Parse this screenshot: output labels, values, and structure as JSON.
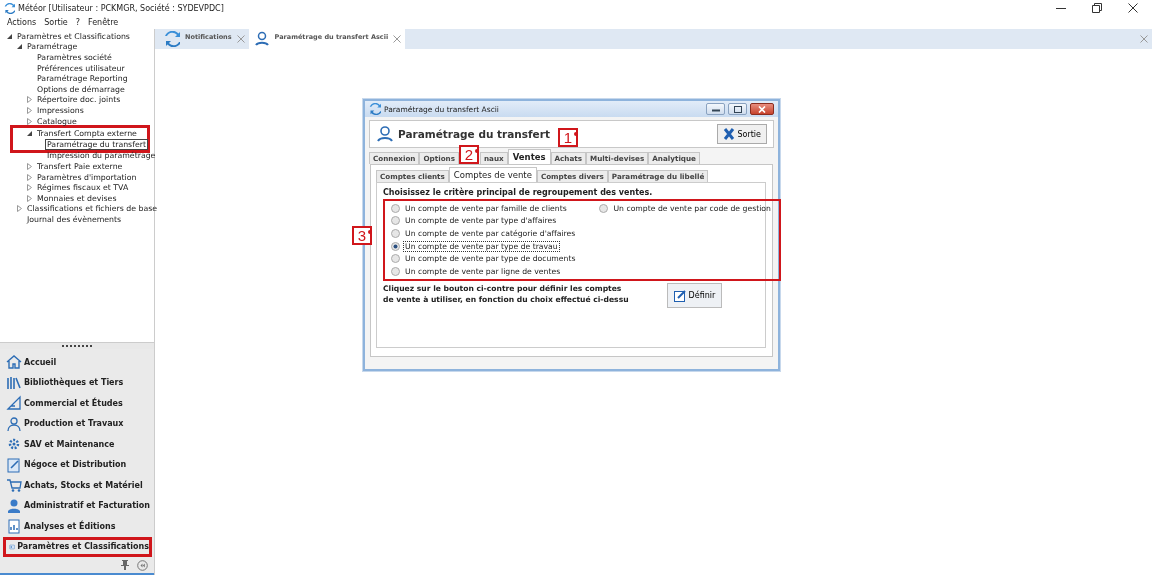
{
  "window": {
    "title": "Météor [Utilisateur : PCKMGR, Société : SYDEVPDC]"
  },
  "menu": [
    "Actions",
    "Sortie",
    "?",
    "Fenêtre"
  ],
  "tree": [
    {
      "label": "Paramètres et Classifications",
      "expanded": true,
      "selected": false,
      "highlighted": false,
      "children": [
        {
          "label": "Paramétrage",
          "expanded": true,
          "selected": false,
          "highlighted": false,
          "children": [
            {
              "label": "Paramètres société",
              "selected": false,
              "highlighted": false
            },
            {
              "label": "Préférences utilisateur",
              "selected": false,
              "highlighted": false
            },
            {
              "label": "Paramétrage Reporting",
              "selected": false,
              "highlighted": false
            },
            {
              "label": "Options de démarrage",
              "selected": false,
              "highlighted": false
            },
            {
              "label": "Répertoire doc. joints",
              "expanded": false,
              "selected": false,
              "highlighted": false
            },
            {
              "label": "Impressions",
              "expanded": false,
              "selected": false,
              "highlighted": false
            },
            {
              "label": "Catalogue",
              "expanded": false,
              "selected": false,
              "highlighted": false
            },
            {
              "label": "Transfert Compta externe",
              "expanded": true,
              "selected": false,
              "highlighted": true,
              "children": [
                {
                  "label": "Paramétrage du transfert",
                  "selected": true,
                  "highlighted": false
                },
                {
                  "label": "Impression du paramétrage",
                  "selected": false,
                  "highlighted": false
                }
              ]
            },
            {
              "label": "Transfert Paie externe",
              "expanded": false,
              "selected": false,
              "highlighted": false
            },
            {
              "label": "Paramètres d'importation",
              "expanded": false,
              "selected": false,
              "highlighted": false
            },
            {
              "label": "Régimes fiscaux et TVA",
              "expanded": false,
              "selected": false,
              "highlighted": false
            },
            {
              "label": "Monnaies et devises",
              "expanded": false,
              "selected": false,
              "highlighted": false
            }
          ]
        },
        {
          "label": "Classifications et fichiers de base",
          "expanded": false,
          "selected": false,
          "highlighted": false
        },
        {
          "label": "Journal des évènements",
          "selected": false,
          "highlighted": false
        }
      ]
    }
  ],
  "nav": [
    {
      "label": "Accueil",
      "highlighted": false
    },
    {
      "label": "Bibliothèques et Tiers",
      "highlighted": false
    },
    {
      "label": "Commercial et Études",
      "highlighted": false
    },
    {
      "label": "Production et Travaux",
      "highlighted": false
    },
    {
      "label": "SAV et Maintenance",
      "highlighted": false
    },
    {
      "label": "Négoce et Distribution",
      "highlighted": false
    },
    {
      "label": "Achats, Stocks et Matériel",
      "highlighted": false
    },
    {
      "label": "Administratif et Facturation",
      "highlighted": false
    },
    {
      "label": "Analyses et Éditions",
      "highlighted": false
    },
    {
      "label": "Paramètres et Classifications",
      "highlighted": true
    }
  ],
  "doc_tabs": [
    {
      "label": "Notifications",
      "selected": false
    },
    {
      "label": "Paramétrage du transfert Ascii",
      "selected": true
    }
  ],
  "dialog": {
    "title": "Paramétrage du transfert Ascii",
    "header": "Paramétrage du transfert",
    "exit_button": "Sortie",
    "tabs": [
      {
        "label": "Connexion",
        "selected": false
      },
      {
        "label": "Options",
        "selected": false
      },
      {
        "label": "naux",
        "selected": false
      },
      {
        "label": "Ventes",
        "selected": true
      },
      {
        "label": "Achats",
        "selected": false
      },
      {
        "label": "Multi-devises",
        "selected": false
      },
      {
        "label": "Analytique",
        "selected": false
      }
    ],
    "subtabs": [
      {
        "label": "Comptes clients",
        "selected": false
      },
      {
        "label": "Comptes de vente",
        "selected": true
      },
      {
        "label": "Comptes divers",
        "selected": false
      },
      {
        "label": "Paramétrage du libellé",
        "selected": false
      }
    ],
    "heading": "Choisissez le critère principal de regroupement des ventes.",
    "options_highlighted": true,
    "option_columns": [
      [
        {
          "label": "Un compte de vente par famille de clients",
          "selected": false,
          "focused": false
        },
        {
          "label": "Un compte de vente par type d'affaires",
          "selected": false,
          "focused": false
        },
        {
          "label": "Un compte de vente par catégorie d'affaires",
          "selected": false,
          "focused": false
        },
        {
          "label": "Un compte de vente par type de travau",
          "selected": true,
          "focused": true
        },
        {
          "label": "Un compte de vente par type de documents",
          "selected": false,
          "focused": false
        },
        {
          "label": "Un compte de vente par ligne de ventes",
          "selected": false,
          "focused": false
        }
      ],
      [
        {
          "label": "Un compte de vente par code de gestion",
          "selected": false,
          "focused": false
        }
      ]
    ],
    "hint": [
      "Cliquez sur le bouton ci-contre pour définir les comptes",
      "de vente à utiliser, en fonction du choix effectué ci-dessu"
    ],
    "define_button": "Définir"
  },
  "callouts": [
    {
      "label": "1"
    },
    {
      "label": "2"
    },
    {
      "label": "3"
    }
  ]
}
